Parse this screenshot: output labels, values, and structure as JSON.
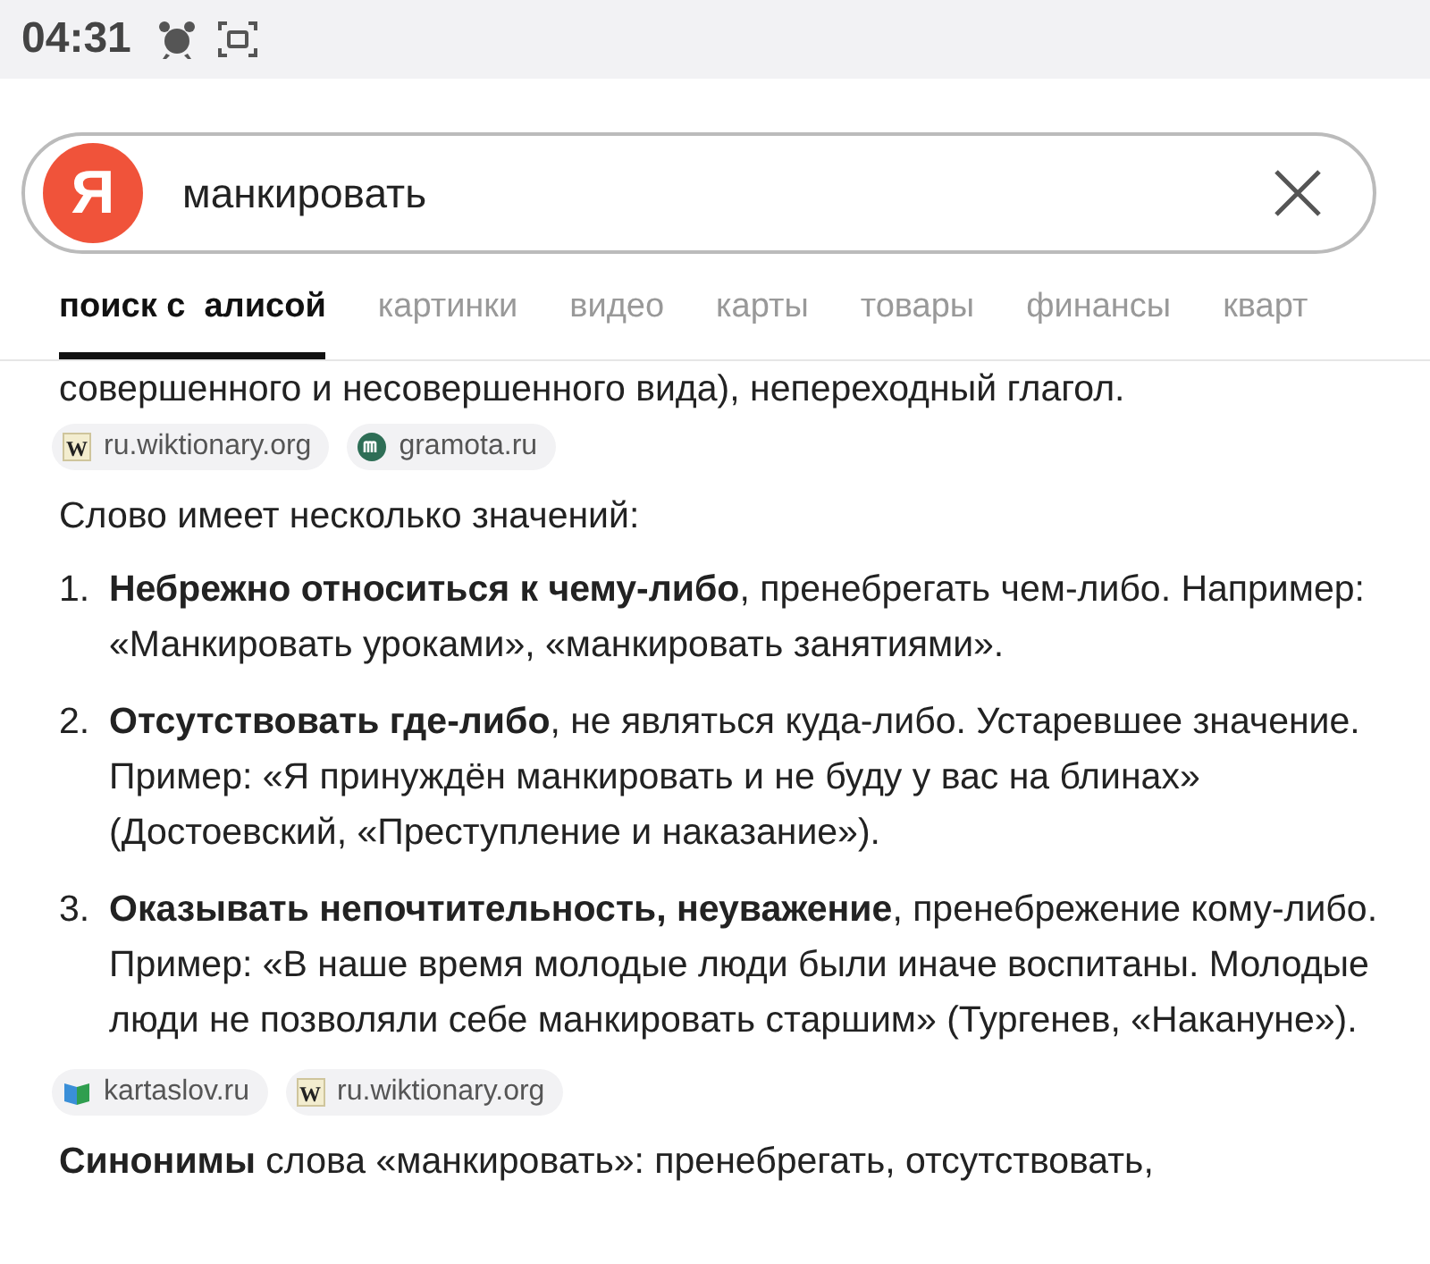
{
  "status_bar": {
    "time": "04:31"
  },
  "search": {
    "logo": "Я",
    "value": "манкировать"
  },
  "tabs": [
    {
      "label": "поиск с  алисой",
      "selected": true
    },
    {
      "label": "картинки",
      "selected": false
    },
    {
      "label": "видео",
      "selected": false
    },
    {
      "label": "карты",
      "selected": false
    },
    {
      "label": "товары",
      "selected": false
    },
    {
      "label": "финансы",
      "selected": false
    },
    {
      "label": "кварт",
      "selected": false
    }
  ],
  "intro_tail": "совершенного и несовершенного вида), непереходный глагол.",
  "sources_top": [
    {
      "kind": "wiki",
      "icon_text": "W",
      "label": "ru.wiktionary.org"
    },
    {
      "kind": "gramota",
      "label": "gramota.ru"
    }
  ],
  "meanings_heading": "Слово имеет несколько значений:",
  "meanings": [
    {
      "number": "1.",
      "text": "**Небрежно относиться к чему-либо**, пренебрегать чем-либо. Например: «Манкировать уроками», «манкировать занятиями»."
    },
    {
      "number": "2.",
      "text": "**Отсутствовать где-либо**, не являться куда-либо. Устаревшее значение. Пример: «Я принуждён манкировать и не буду у вас на блинах» (Достоевский, «Преступление и наказание»)."
    },
    {
      "number": "3.",
      "text": "**Оказывать непочтительность, неуважение**, пренебрежение кому-либо. Пример: «В наше время молодые люди были иначе воспитаны. Молодые люди не позволяли себе манкировать старшим» (Тургенев, «Накануне»)."
    }
  ],
  "sources_bottom": [
    {
      "kind": "book",
      "label": "kartaslov.ru"
    },
    {
      "kind": "wiki",
      "icon_text": "W",
      "label": "ru.wiktionary.org"
    }
  ],
  "synonyms": "**Синонимы** слова «манкировать»: пренебрегать, отсутствовать,"
}
